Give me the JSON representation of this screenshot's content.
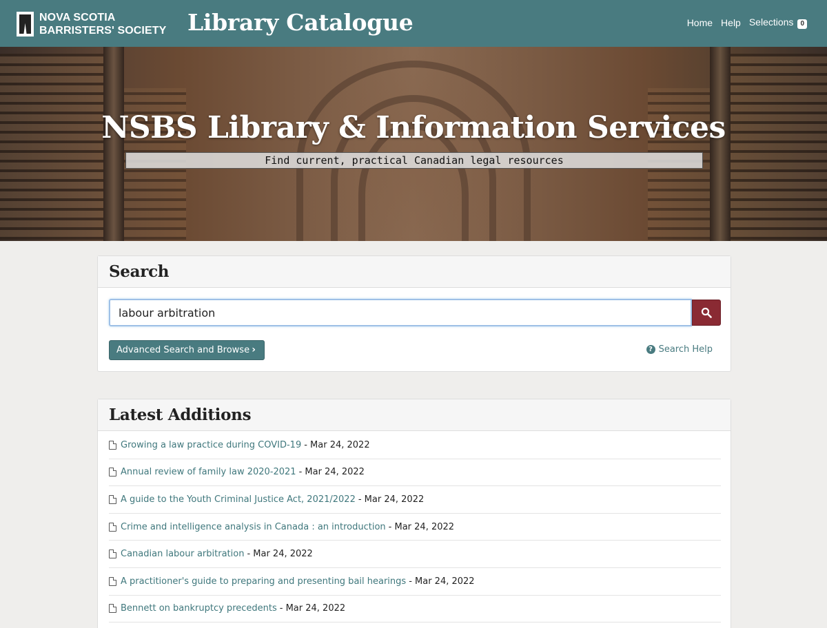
{
  "header": {
    "logo_line1": "NOVA SCOTIA",
    "logo_line2": "BARRISTERS' SOCIETY",
    "app_title": "Library Catalogue",
    "nav": {
      "home": "Home",
      "help": "Help",
      "selections": "Selections",
      "selections_count": "0"
    }
  },
  "hero": {
    "title": "NSBS Library & Information Services",
    "subtitle": "Find current, practical Canadian legal resources"
  },
  "search": {
    "heading": "Search",
    "query": "labour arbitration",
    "advanced_label": "Advanced Search and Browse",
    "help_label": "Search Help"
  },
  "latest": {
    "heading": "Latest Additions",
    "items": [
      {
        "title": "Growing a law practice during COVID-19",
        "date": "- Mar 24, 2022"
      },
      {
        "title": "Annual review of family law 2020-2021",
        "date": "- Mar 24, 2022"
      },
      {
        "title": "A guide to the Youth Criminal Justice Act, 2021/2022",
        "date": "- Mar 24, 2022"
      },
      {
        "title": "Crime and intelligence analysis in Canada : an introduction",
        "date": "- Mar 24, 2022"
      },
      {
        "title": "Canadian labour arbitration",
        "date": "- Mar 24, 2022"
      },
      {
        "title": "A practitioner's guide to preparing and presenting bail hearings",
        "date": "- Mar 24, 2022"
      },
      {
        "title": "Bennett on bankruptcy precedents",
        "date": "- Mar 24, 2022"
      }
    ]
  },
  "colors": {
    "brand_teal": "#497b80",
    "search_button": "#8a2a33",
    "link": "#3f777c"
  },
  "icons": {
    "logo": "gown-logo-icon",
    "search": "magnifier-icon",
    "help": "question-circle-icon",
    "item": "document-icon",
    "chevron": "chevron-right-icon"
  }
}
